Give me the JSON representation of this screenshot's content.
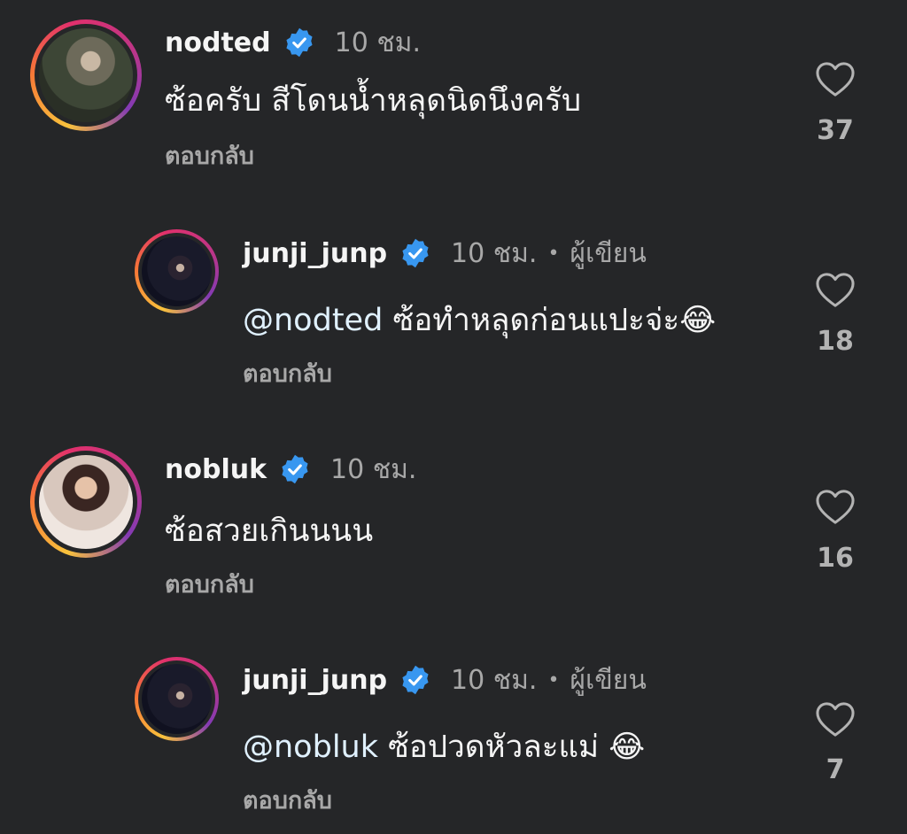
{
  "comments": [
    {
      "username": "nodted",
      "time": "10 ชม.",
      "text": "ซ้อครับ สีโดนน้ำหลุดนิดนึงครับ",
      "reply_label": "ตอบกลับ",
      "likes": "37"
    },
    {
      "username": "junji_junp",
      "time": "10 ชม.",
      "dot": "•",
      "author_label": "ผู้เขียน",
      "mention": "@nodted",
      "text": "ซ้อทำหลุดก่อนแปะจ่ะ",
      "emoji": "😂",
      "reply_label": "ตอบกลับ",
      "likes": "18"
    },
    {
      "username": "nobluk",
      "time": "10 ชม.",
      "text": "ซ้อสวยเกินนนน",
      "reply_label": "ตอบกลับ",
      "likes": "16"
    },
    {
      "username": "junji_junp",
      "time": "10 ชม.",
      "dot": "•",
      "author_label": "ผู้เขียน",
      "mention": "@nobluk",
      "text": "ซ้อปวดหัวละแม่",
      "emoji": "😂",
      "reply_label": "ตอบกลับ",
      "likes": "7"
    }
  ],
  "colors": {
    "background": "#252628",
    "verified": "#3897f0",
    "secondary_text": "#a8a8a8"
  }
}
